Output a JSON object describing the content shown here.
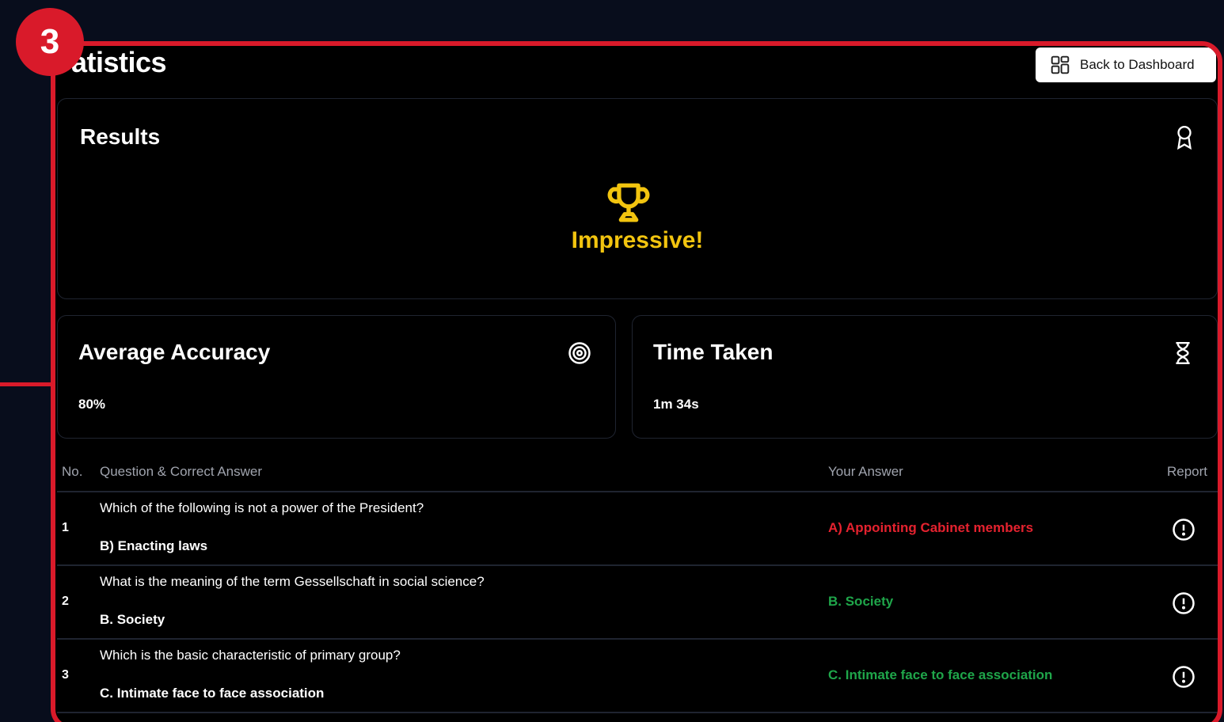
{
  "annotation": {
    "badge": "3",
    "color": "#d91a2a"
  },
  "page": {
    "title": "atistics"
  },
  "header": {
    "back_button_label": "Back to Dashboard"
  },
  "results": {
    "title": "Results",
    "message": "Impressive!",
    "message_color": "#f2c40f",
    "icon": "award-ribbon-icon"
  },
  "accuracy": {
    "title": "Average Accuracy",
    "value": "80%",
    "icon": "target-icon"
  },
  "time": {
    "title": "Time Taken",
    "value": "1m 34s",
    "icon": "hourglass-icon"
  },
  "table": {
    "headers": {
      "no": "No.",
      "question": "Question & Correct Answer",
      "your_answer": "Your Answer",
      "report": "Report"
    },
    "rows": [
      {
        "no": "1",
        "question": "Which of the following is not a power of the President?",
        "correct": "B) Enacting laws",
        "your_answer": "A) Appointing Cabinet members",
        "status": "wrong"
      },
      {
        "no": "2",
        "question": "What is the meaning of the term Gessellschaft in social science?",
        "correct": "B. Society",
        "your_answer": "B. Society",
        "status": "right"
      },
      {
        "no": "3",
        "question": "Which is the basic characteristic of primary group?",
        "correct": "C. Intimate face to face association",
        "your_answer": "C. Intimate face to face association",
        "status": "right"
      }
    ]
  },
  "colors": {
    "wrong": "#e5222f",
    "right": "#1fa64a",
    "background": "#000000"
  }
}
